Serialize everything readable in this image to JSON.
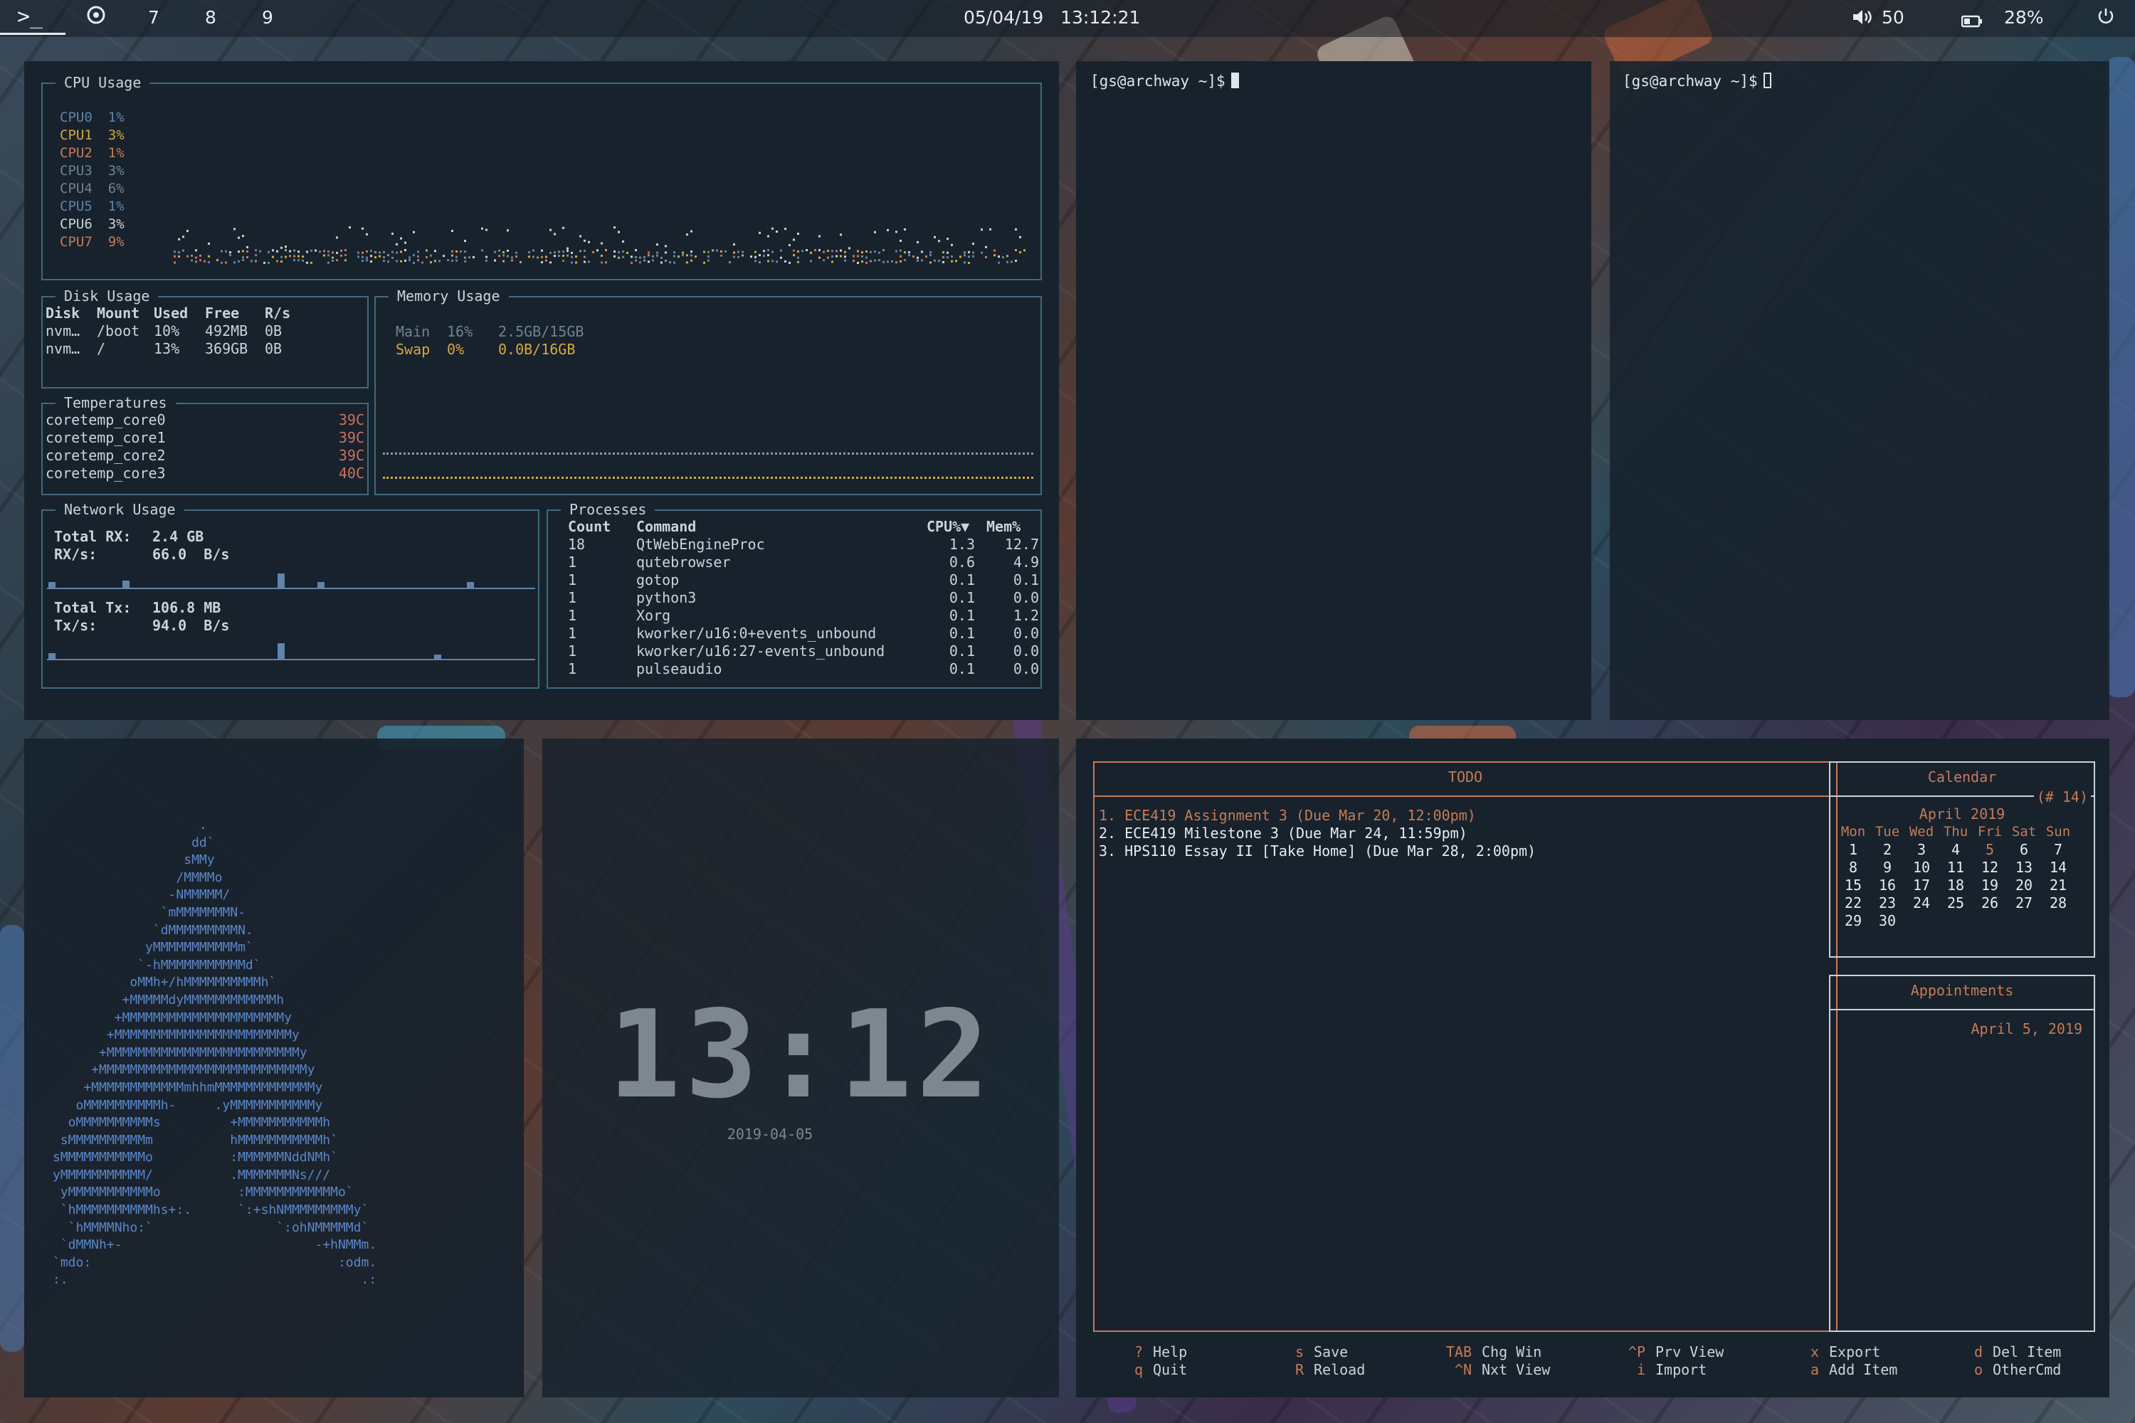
{
  "colors": {
    "accent_orange": "#c77a55",
    "accent_blue": "#5f84a8",
    "panel_bg": "#17222d",
    "border_blue": "#3f6a7e",
    "temp_red": "#d0705a"
  },
  "topbar": {
    "terminal_icon": "terminal-icon",
    "chrome_icon": "browser-icon",
    "workspaces": [
      "7",
      "8",
      "9"
    ],
    "datetime": "05/04/19   13:12:21",
    "volume_icon": "speaker-icon",
    "volume": "50",
    "battery_icon": "battery-icon",
    "battery": "28%",
    "power_icon": "power-icon"
  },
  "gotop": {
    "cpu_title": "CPU Usage",
    "cpus": [
      {
        "name": "CPU0",
        "pct": "1%",
        "color": "#5f84a8"
      },
      {
        "name": "CPU1",
        "pct": "3%",
        "color": "#d6a83c"
      },
      {
        "name": "CPU2",
        "pct": "1%",
        "color": "#c77a55"
      },
      {
        "name": "CPU3",
        "pct": "3%",
        "color": "#6d8296"
      },
      {
        "name": "CPU4",
        "pct": "6%",
        "color": "#6d8296"
      },
      {
        "name": "CPU5",
        "pct": "1%",
        "color": "#5f84a8"
      },
      {
        "name": "CPU6",
        "pct": "3%",
        "color": "#c9d3dc"
      },
      {
        "name": "CPU7",
        "pct": "9%",
        "color": "#c77a55"
      }
    ],
    "disk": {
      "title": "Disk Usage",
      "headers": [
        "Disk",
        "Mount",
        "Used",
        "Free",
        "R/s"
      ],
      "rows": [
        [
          "nvm…",
          "/boot",
          "10%",
          "492MB",
          "0B"
        ],
        [
          "nvm…",
          "/",
          "13%",
          "369GB",
          "0B"
        ]
      ]
    },
    "memory": {
      "title": "Memory Usage",
      "main_label": "Main",
      "main_pct": "16%",
      "main_val": "2.5GB/15GB",
      "swap_label": "Swap",
      "swap_pct": "0%",
      "swap_val": "0.0B/16GB",
      "main_level": 0.16,
      "swap_level": 0.0
    },
    "temps": {
      "title": "Temperatures",
      "rows": [
        [
          "coretemp_core0",
          "39C"
        ],
        [
          "coretemp_core1",
          "39C"
        ],
        [
          "coretemp_core2",
          "39C"
        ],
        [
          "coretemp_core3",
          "40C"
        ]
      ]
    },
    "network": {
      "title": "Network Usage",
      "total_rx_label": "Total RX:",
      "total_rx": "2.4 GB",
      "rxs_label": "RX/s:",
      "rxs": "66.0  B/s",
      "total_tx_label": "Total Tx:",
      "total_tx": "106.8 MB",
      "txs_label": "Tx/s:",
      "txs": "94.0  B/s"
    },
    "processes": {
      "title": "Processes",
      "headers": [
        "Count",
        "Command",
        "CPU%▼",
        "Mem%"
      ],
      "rows": [
        [
          "18",
          "QtWebEngineProc",
          "1.3",
          "12.7"
        ],
        [
          "1",
          "qutebrowser",
          "0.6",
          "4.9"
        ],
        [
          "1",
          "gotop",
          "0.1",
          "0.1"
        ],
        [
          "1",
          "python3",
          "0.1",
          "0.0"
        ],
        [
          "1",
          "Xorg",
          "0.1",
          "1.2"
        ],
        [
          "1",
          "kworker/u16:0+events_unbound",
          "0.1",
          "0.0"
        ],
        [
          "1",
          "kworker/u16:27-events_unbound",
          "0.1",
          "0.0"
        ],
        [
          "1",
          "pulseaudio",
          "0.1",
          "0.0"
        ]
      ]
    }
  },
  "terminals": [
    {
      "prompt": "[gs@archway ~]$"
    },
    {
      "prompt": "[gs@archway ~]$"
    }
  ],
  "clock": {
    "time": "13:12",
    "date": "2019-04-05"
  },
  "neofetch_logo": "                   .\n                  dd`\n                 sMMy\n                /MMMMo\n               -NMMMMM/\n              `mMMMMMMMN-\n             `dMMMMMMMMMN.\n            yMMMMMMMMMMMm`\n           `-hMMMMMMMMMMMd`\n          oMMh+/hMMMMMMMMMMh`\n         +MMMMMdyMMMMMMMMMMMMh\n        +MMMMMMMMMMMMMMMMMMMMMy\n       +MMMMMMMMMMMMMMMMMMMMMMMy\n      +MMMMMMMMMMMMMMMMMMMMMMMMMy\n     +MMMMMMMMMMMMMMMMMMMMMMMMMMMy\n    +MMMMMMMMMMMMmhhmMMMMMMMMMMMMMy\n   oMMMMMMMMMMh-     .yMMMMMMMMMMMy\n  oMMMMMMMMMMs         +MMMMMMMMMMMh\n sMMMMMMMMMMm          hMMMMMMMMMMMh`\nsMMMMMMMMMMMo          :MMMMMMNddNMh`\nyMMMMMMMMMMM/          .MMMMMMMNs///\n yMMMMMMMMMMMo          :MMMMMMMMMMMMo`\n `hMMMMMMMMMMhs+:.      `:+shNMMMMMMMMMy`\n  `hMMMMNho:`                `:ohNMMMMMd`\n `dMMNh+-                         -+hNMMm.\n`mdo:                                :odm.\n:.                                      .:",
  "calcurse": {
    "todo_title": "TODO",
    "todos": [
      "1. ECE419 Assignment 3 (Due Mar 20, 12:00pm)",
      "2. ECE419 Milestone 3 (Due Mar 24, 11:59pm)",
      "3. HPS110 Essay II [Take Home] (Due Mar 28, 2:00pm)"
    ],
    "calendar_title": "Calendar",
    "week_label": "(# 14)",
    "month": "April 2019",
    "weekdays": [
      "Mon",
      "Tue",
      "Wed",
      "Thu",
      "Fri",
      "Sat",
      "Sun"
    ],
    "weeks": [
      [
        "1",
        "2",
        "3",
        "4",
        "5",
        "6",
        "7"
      ],
      [
        "8",
        "9",
        "10",
        "11",
        "12",
        "13",
        "14"
      ],
      [
        "15",
        "16",
        "17",
        "18",
        "19",
        "20",
        "21"
      ],
      [
        "22",
        "23",
        "24",
        "25",
        "26",
        "27",
        "28"
      ],
      [
        "29",
        "30",
        "",
        "",
        "",
        "",
        ""
      ]
    ],
    "today": "5",
    "appointments_title": "Appointments",
    "appointments_date": "April 5, 2019",
    "keys": [
      [
        [
          "?",
          "Help"
        ],
        [
          "q",
          "Quit"
        ]
      ],
      [
        [
          "s",
          "Save"
        ],
        [
          "R",
          "Reload"
        ]
      ],
      [
        [
          "TAB",
          "Chg Win"
        ],
        [
          "^N",
          "Nxt View"
        ]
      ],
      [
        [
          "^P",
          "Prv View"
        ],
        [
          "i",
          "Import"
        ]
      ],
      [
        [
          "x",
          "Export"
        ],
        [
          "a",
          "Add Item"
        ]
      ],
      [
        [
          "d",
          "Del Item"
        ],
        [
          "o",
          "OtherCmd"
        ]
      ]
    ]
  }
}
